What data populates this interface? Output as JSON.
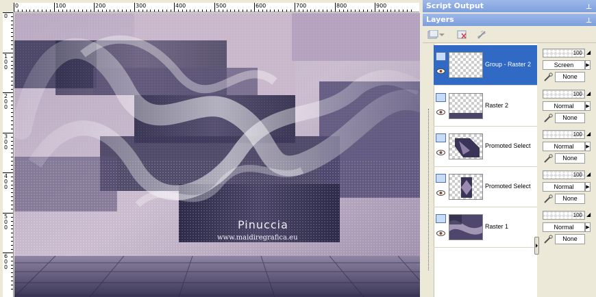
{
  "ruler": {
    "top_labels": [
      "0",
      "100",
      "200",
      "300",
      "400",
      "500",
      "600",
      "700",
      "800",
      "900"
    ],
    "left_labels": [
      "0",
      "100",
      "200",
      "300",
      "400",
      "500",
      "600"
    ]
  },
  "artwork": {
    "signature": "Pinuccia",
    "url": "www.maidiregrafica.eu"
  },
  "script_output": {
    "title": "Script Output"
  },
  "layers_panel": {
    "title": "Layers",
    "layers": [
      {
        "name": "Group - Raster 2",
        "opacity": "100",
        "blend": "Screen",
        "mask": "None",
        "selected": true
      },
      {
        "name": "Raster 2",
        "opacity": "100",
        "blend": "Normal",
        "mask": "None",
        "selected": false
      },
      {
        "name": "Promoted Select",
        "opacity": "100",
        "blend": "Normal",
        "mask": "None",
        "selected": false
      },
      {
        "name": "Promoted Select",
        "opacity": "100",
        "blend": "Normal",
        "mask": "None",
        "selected": false
      },
      {
        "name": "Raster 1",
        "opacity": "100",
        "blend": "Normal",
        "mask": "None",
        "selected": false
      }
    ]
  },
  "colors": {
    "title_bar": "#7d9fdd",
    "selection": "#316ac5",
    "artwork_base": "#cdbfd0",
    "artwork_dark": "#2a2846"
  }
}
